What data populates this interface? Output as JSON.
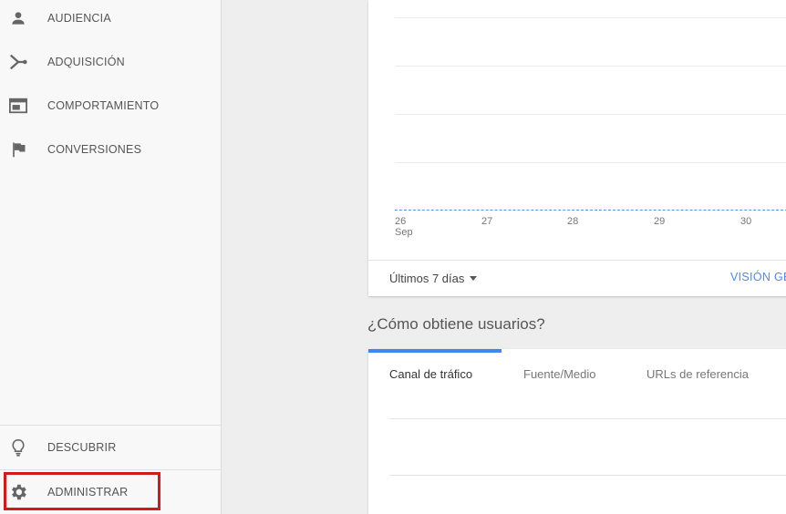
{
  "sidebar": {
    "items": [
      {
        "label": "AUDIENCIA",
        "icon": "person-icon"
      },
      {
        "label": "ADQUISICIÓN",
        "icon": "acquisition-icon"
      },
      {
        "label": "COMPORTAMIENTO",
        "icon": "behavior-icon"
      },
      {
        "label": "CONVERSIONES",
        "icon": "flag-icon"
      }
    ],
    "bottom_items": [
      {
        "label": "DESCUBRIR",
        "icon": "lightbulb-icon"
      },
      {
        "label": "ADMINISTRAR",
        "icon": "gear-icon"
      }
    ]
  },
  "chart_card": {
    "chart_data": {
      "type": "line",
      "x": [
        "26\nSep",
        "27",
        "28",
        "29",
        "30"
      ],
      "series": [
        {
          "values": [
            0,
            0,
            0,
            0,
            0
          ]
        }
      ]
    },
    "x_ticks": [
      {
        "label": "26",
        "sub": "Sep"
      },
      {
        "label": "27",
        "sub": ""
      },
      {
        "label": "28",
        "sub": ""
      },
      {
        "label": "29",
        "sub": ""
      },
      {
        "label": "30",
        "sub": ""
      }
    ],
    "date_range": "Últimos 7 días",
    "overview_link": "VISIÓN GE"
  },
  "acquisition": {
    "title": "¿Cómo obtiene usuarios?",
    "tabs": [
      {
        "label": "Canal de tráfico",
        "active": true
      },
      {
        "label": "Fuente/Medio",
        "active": false
      },
      {
        "label": "URLs de referencia",
        "active": false
      }
    ]
  },
  "colors": {
    "accent": "#4285f4",
    "highlight": "#d11a1a"
  }
}
